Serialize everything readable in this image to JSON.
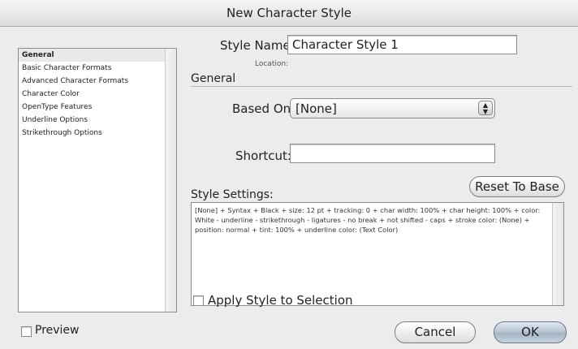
{
  "window": {
    "title": "New Character Style"
  },
  "sidebar": {
    "items": [
      {
        "label": "General",
        "selected": true
      },
      {
        "label": "Basic Character Formats",
        "selected": false
      },
      {
        "label": "Advanced Character Formats",
        "selected": false
      },
      {
        "label": "Character Color",
        "selected": false
      },
      {
        "label": "OpenType Features",
        "selected": false
      },
      {
        "label": "Underline Options",
        "selected": false
      },
      {
        "label": "Strikethrough Options",
        "selected": false
      }
    ]
  },
  "main": {
    "style_name_label": "Style Name:",
    "style_name_value": "Character Style 1",
    "location_label": "Location:",
    "section_title": "General",
    "based_on_label": "Based On:",
    "based_on_value": "[None]",
    "shortcut_label": "Shortcut:",
    "shortcut_value": "",
    "reset_button": "Reset To Base",
    "style_settings_label": "Style Settings:",
    "style_settings_text": "[None] + Syntax + Black + size: 12 pt + tracking: 0 + char width: 100% + char height: 100% + color: White - underline - strikethrough - ligatures - no break + not shifted - caps + stroke color: (None) + position: normal + tint: 100% + underline color: (Text Color)",
    "apply_label": "Apply Style to Selection",
    "apply_checked": false
  },
  "footer": {
    "preview_label": "Preview",
    "preview_checked": false,
    "cancel_button": "Cancel",
    "ok_button": "OK"
  }
}
